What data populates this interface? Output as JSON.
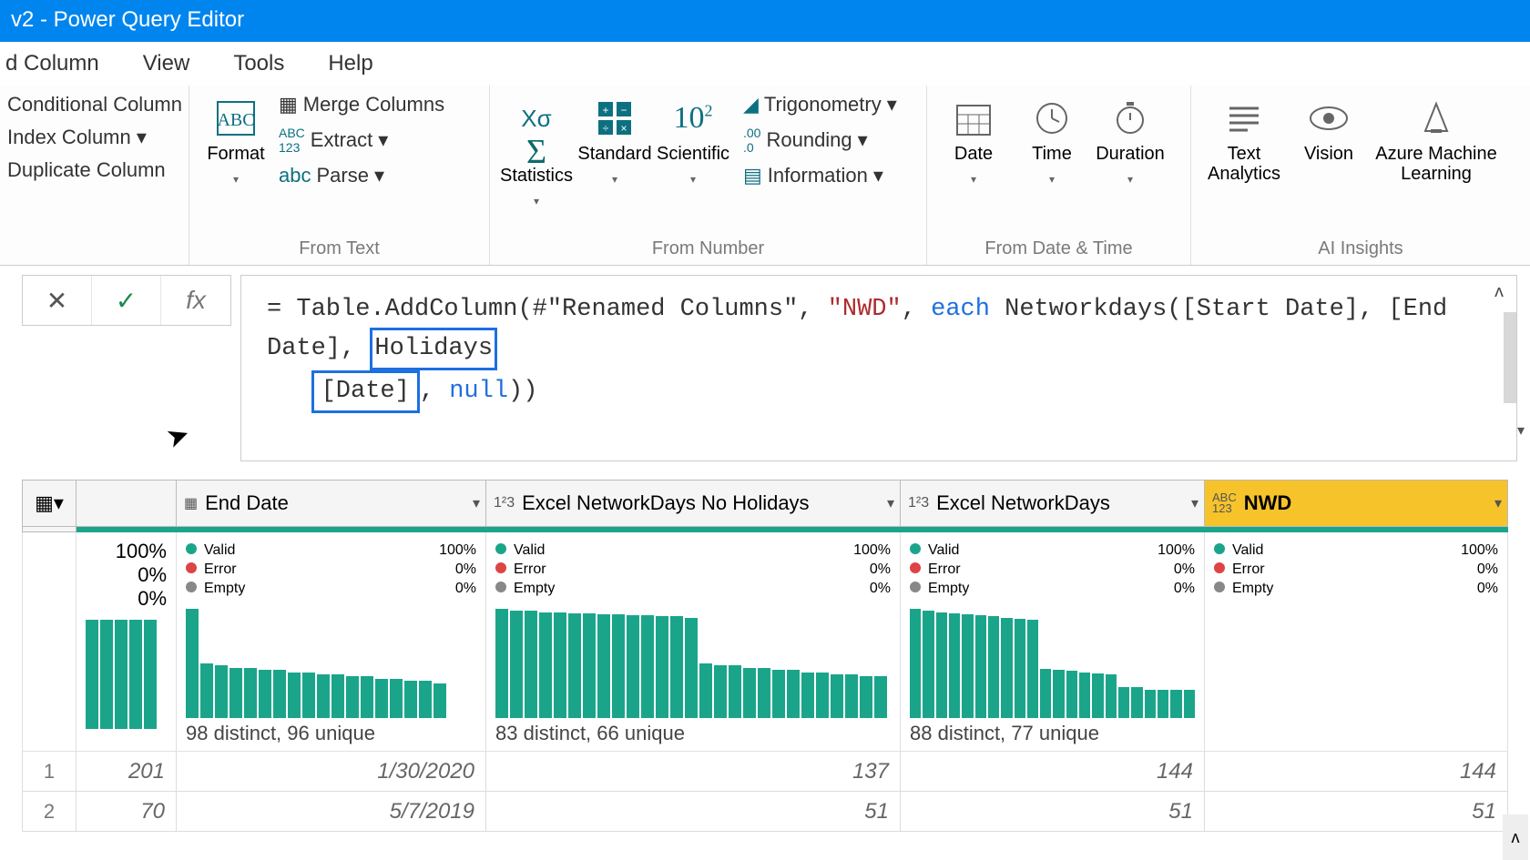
{
  "title": "v2 - Power Query Editor",
  "menu": {
    "addColumn": "d Column",
    "view": "View",
    "tools": "Tools",
    "help": "Help"
  },
  "ribbon": {
    "col1": {
      "conditional": "Conditional Column",
      "index": "Index Column",
      "duplicate": "Duplicate Column"
    },
    "format": "Format",
    "text": {
      "merge": "Merge Columns",
      "extract": "Extract",
      "parse": "Parse"
    },
    "textGroup": "From Text",
    "stats": "Statistics",
    "standard": "Standard",
    "scientific": "Scientific",
    "trig": "Trigonometry",
    "round": "Rounding",
    "info": "Information",
    "numberGroup": "From Number",
    "date": "Date",
    "time": "Time",
    "duration": "Duration",
    "dateGroup": "From Date & Time",
    "textAnalytics": "Text Analytics",
    "vision": "Vision",
    "aml": "Azure Machine Learning",
    "aiGroup": "AI Insights"
  },
  "formula": {
    "pre1": "= Table.AddColumn(#\"Renamed Columns\", ",
    "str": "\"NWD\"",
    "comma1": ", ",
    "each": "each",
    "mid": " Networkdays([Start Date], [End Date],",
    "holidays": "Holidays",
    "line2a": "[Date]",
    "line2b": ", ",
    "null": "null",
    "line2c": "))"
  },
  "columns": {
    "endDate": {
      "name": "End Date",
      "valid": "Valid",
      "error": "Error",
      "empty": "Empty",
      "vpct": "100%",
      "epct": "0%",
      "empct": "0%",
      "distinct": "98 distinct, 96 unique"
    },
    "noHol": {
      "name": "Excel NetworkDays No Holidays",
      "valid": "Valid",
      "error": "Error",
      "empty": "Empty",
      "vpct": "100%",
      "epct": "0%",
      "empct": "0%",
      "distinct": "83 distinct, 66 unique"
    },
    "hol": {
      "name": "Excel NetworkDays",
      "valid": "Valid",
      "error": "Error",
      "empty": "Empty",
      "vpct": "100%",
      "epct": "0%",
      "empct": "0%",
      "distinct": "88 distinct, 77 unique"
    },
    "nwd": {
      "name": "NWD",
      "valid": "Valid",
      "error": "Error",
      "empty": "Empty",
      "vpct": "100%",
      "epct": "0%",
      "empct": "0%"
    }
  },
  "startStub": {
    "pct1": "100%",
    "pct2": "0%",
    "pct3": "0%"
  },
  "rows": [
    {
      "n": "1",
      "start": "201",
      "end": "1/30/2020",
      "noHol": "137",
      "hol": "144",
      "nwd": "144"
    },
    {
      "n": "2",
      "start": "70",
      "end": "5/7/2019",
      "noHol": "51",
      "hol": "51",
      "nwd": "51"
    }
  ],
  "chart_data": [
    {
      "type": "bar",
      "title": "Start stub distribution",
      "values": [
        100,
        100,
        100,
        100,
        100
      ],
      "ylim": [
        0,
        100
      ]
    },
    {
      "type": "bar",
      "title": "End Date distribution",
      "values": [
        100,
        50,
        48,
        46,
        46,
        44,
        44,
        42,
        42,
        40,
        40,
        38,
        38,
        36,
        36,
        34,
        34,
        32
      ],
      "ylim": [
        0,
        100
      ]
    },
    {
      "type": "bar",
      "title": "Excel NetworkDays No Holidays distribution",
      "values": [
        100,
        98,
        98,
        97,
        97,
        96,
        96,
        95,
        95,
        94,
        94,
        93,
        93,
        92,
        50,
        48,
        48,
        46,
        46,
        44,
        44,
        42,
        42,
        40,
        40,
        38,
        38
      ],
      "ylim": [
        0,
        100
      ]
    },
    {
      "type": "bar",
      "title": "Excel NetworkDays distribution",
      "values": [
        100,
        98,
        97,
        96,
        95,
        94,
        93,
        92,
        91,
        90,
        45,
        44,
        43,
        42,
        41,
        40,
        28,
        28,
        26,
        26,
        26,
        26
      ],
      "ylim": [
        0,
        100
      ]
    }
  ]
}
